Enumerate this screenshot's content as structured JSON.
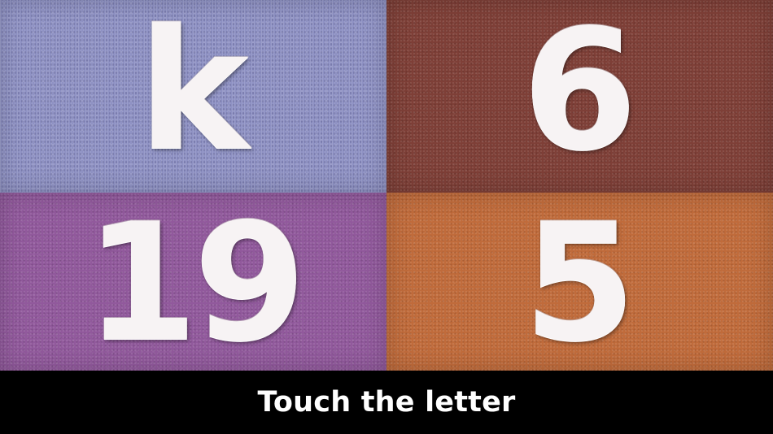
{
  "tiles": [
    {
      "id": "top-left",
      "label": "k",
      "color": "#8f92c4",
      "texture": "knit"
    },
    {
      "id": "top-right",
      "label": "6",
      "color": "#7e3f37",
      "texture": "felt"
    },
    {
      "id": "bottom-left",
      "label": "19",
      "color": "#91599c",
      "texture": "felt"
    },
    {
      "id": "bottom-right",
      "label": "5",
      "color": "#c06b3b",
      "texture": "felt"
    }
  ],
  "instruction": {
    "text": "Touch the letter"
  }
}
